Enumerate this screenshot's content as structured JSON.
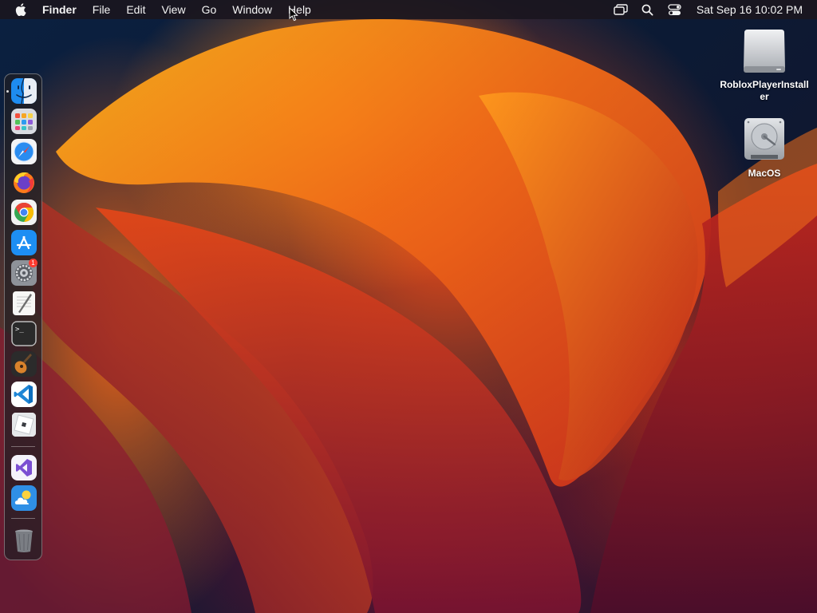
{
  "menubar": {
    "apple_icon": "apple-logo-icon",
    "items": [
      {
        "label": "Finder",
        "bold": true
      },
      {
        "label": "File"
      },
      {
        "label": "Edit"
      },
      {
        "label": "View"
      },
      {
        "label": "Go"
      },
      {
        "label": "Window"
      },
      {
        "label": "Help"
      }
    ],
    "status_icons": [
      "screen-mirroring-icon",
      "spotlight-search-icon",
      "control-center-icon"
    ],
    "clock": "Sat Sep 16  10:02 PM"
  },
  "dock": {
    "apps": [
      {
        "name": "finder",
        "icon": "finder-icon",
        "running": true
      },
      {
        "name": "launchpad",
        "icon": "launchpad-icon"
      },
      {
        "name": "safari",
        "icon": "safari-icon"
      },
      {
        "name": "firefox",
        "icon": "firefox-icon"
      },
      {
        "name": "chrome",
        "icon": "chrome-icon"
      },
      {
        "name": "app-store",
        "icon": "app-store-icon"
      },
      {
        "name": "system-preferences",
        "icon": "settings-gear-icon",
        "badge": "1"
      },
      {
        "name": "textedit",
        "icon": "textedit-icon"
      },
      {
        "name": "terminal",
        "icon": "terminal-icon"
      },
      {
        "name": "garageband",
        "icon": "garageband-guitar-icon"
      },
      {
        "name": "vscode",
        "icon": "vscode-icon"
      },
      {
        "name": "roblox",
        "icon": "roblox-icon"
      },
      {
        "name": "visual-studio",
        "icon": "visual-studio-icon"
      },
      {
        "name": "weather",
        "icon": "weather-icon"
      },
      {
        "name": "trash",
        "icon": "trash-icon"
      }
    ],
    "terminal_prompt": ">_"
  },
  "desktop": {
    "icons": [
      {
        "label": "RobloxPlayerInstaller",
        "icon": "disk-image-icon"
      },
      {
        "label": "MacOS",
        "icon": "hard-drive-icon"
      }
    ]
  },
  "colors": {
    "menubar_bg": "#1a161e",
    "wallpaper_orange": "#f57d17",
    "wallpaper_red": "#e0491a",
    "wallpaper_navy": "#0b2040",
    "badge_red": "#ff3b30"
  }
}
